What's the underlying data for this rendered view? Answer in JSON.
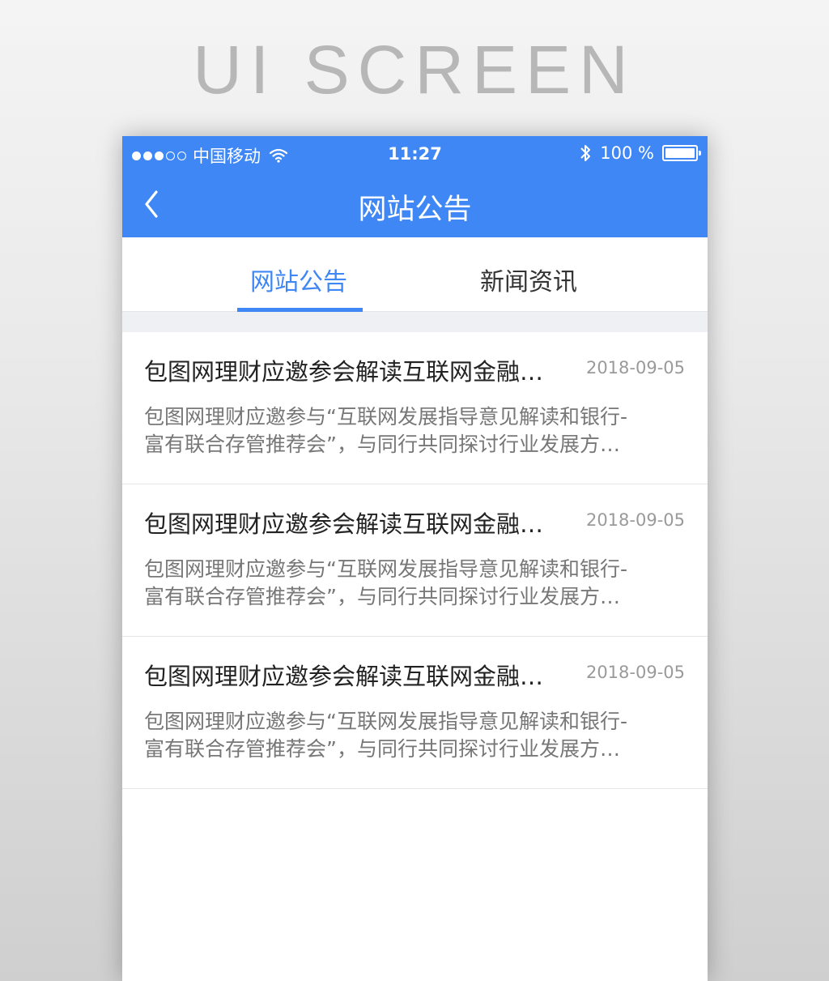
{
  "page_heading": "UI SCREEN",
  "status_bar": {
    "carrier": "中国移动",
    "time": "11:27",
    "battery": "100 %"
  },
  "nav": {
    "title": "网站公告",
    "back_icon": "chevron-left-icon"
  },
  "tabs": [
    {
      "label": "网站公告",
      "active": true
    },
    {
      "label": "新闻资讯",
      "active": false
    }
  ],
  "news": [
    {
      "title": "包图网理财应邀参会解读互联网金融…",
      "date": "2018-09-05",
      "summary_line1": "包图网理财应邀参与“互联网发展指导意见解读和银行-",
      "summary_line2": "富有联合存管推荐会”，与同行共同探讨行业发展方…"
    },
    {
      "title": "包图网理财应邀参会解读互联网金融…",
      "date": "2018-09-05",
      "summary_line1": "包图网理财应邀参与“互联网发展指导意见解读和银行-",
      "summary_line2": "富有联合存管推荐会”，与同行共同探讨行业发展方…"
    },
    {
      "title": "包图网理财应邀参会解读互联网金融…",
      "date": "2018-09-05",
      "summary_line1": "包图网理财应邀参与“互联网发展指导意见解读和银行-",
      "summary_line2": "富有联合存管推荐会”，与同行共同探讨行业发展方…"
    }
  ],
  "colors": {
    "accent": "#3f87f5",
    "tab_divider_band": "#eef0f4",
    "title_text": "#222222",
    "summary_text": "#777777",
    "date_text": "#9a9a9a"
  }
}
